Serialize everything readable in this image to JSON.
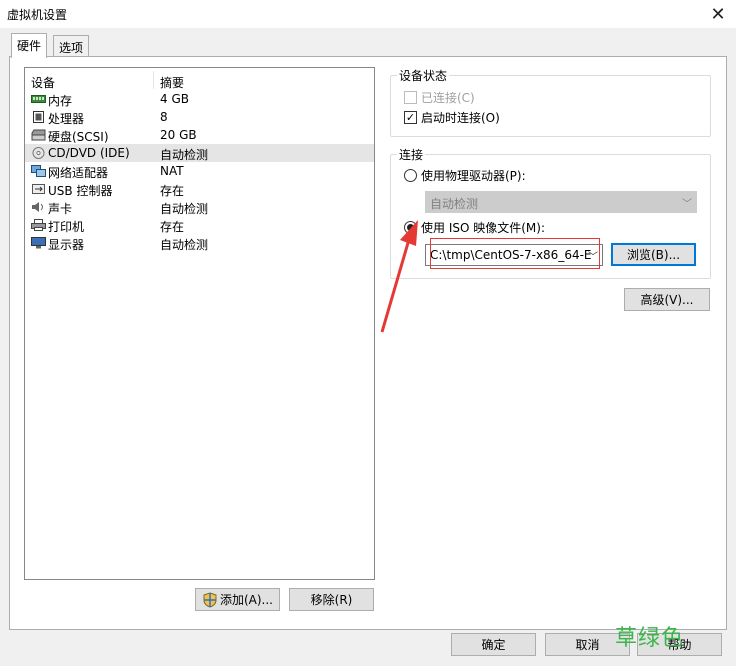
{
  "window": {
    "title": "虚拟机设置",
    "close_glyph": "✕"
  },
  "tabs": [
    {
      "label": "硬件",
      "active": true
    },
    {
      "label": "选项",
      "active": false
    }
  ],
  "device_list": {
    "columns": {
      "device": "设备",
      "summary": "摘要"
    },
    "rows": [
      {
        "device": "内存",
        "summary": "4 GB",
        "icon": "memory-icon"
      },
      {
        "device": "处理器",
        "summary": "8",
        "icon": "processor-icon"
      },
      {
        "device": "硬盘(SCSI)",
        "summary": "20 GB",
        "icon": "hard-disk-icon"
      },
      {
        "device": "CD/DVD (IDE)",
        "summary": "自动检测",
        "icon": "cd-dvd-icon",
        "selected": true
      },
      {
        "device": "网络适配器",
        "summary": "NAT",
        "icon": "network-adapter-icon"
      },
      {
        "device": "USB 控制器",
        "summary": "存在",
        "icon": "usb-icon"
      },
      {
        "device": "声卡",
        "summary": "自动检测",
        "icon": "sound-card-icon"
      },
      {
        "device": "打印机",
        "summary": "存在",
        "icon": "printer-icon"
      },
      {
        "device": "显示器",
        "summary": "自动检测",
        "icon": "display-icon"
      }
    ]
  },
  "buttons": {
    "add": "添加(A)...",
    "remove": "移除(R)",
    "ok": "确定",
    "cancel": "取消",
    "help": "帮助"
  },
  "device_status": {
    "title": "设备状态",
    "connected": {
      "label": "已连接(C)",
      "checked": false,
      "disabled": true
    },
    "connect_at_power_on": {
      "label": "启动时连接(O)",
      "checked": true
    }
  },
  "connection": {
    "title": "连接",
    "physical_drive": {
      "label": "使用物理驱动器(P):",
      "selected": false
    },
    "physical_drive_select": {
      "value": "自动检测",
      "disabled": true
    },
    "iso_image": {
      "label": "使用 ISO 映像文件(M):",
      "selected": true
    },
    "iso_path": "C:\\tmp\\CentOS-7-x86_64-E",
    "browse": "浏览(B)...",
    "advanced": "高级(V)..."
  },
  "watermark": "草绿色",
  "colors": {
    "annotation_red": "#e53935",
    "watermark_green": "#3bb54a",
    "focus_blue": "#0078d7"
  }
}
